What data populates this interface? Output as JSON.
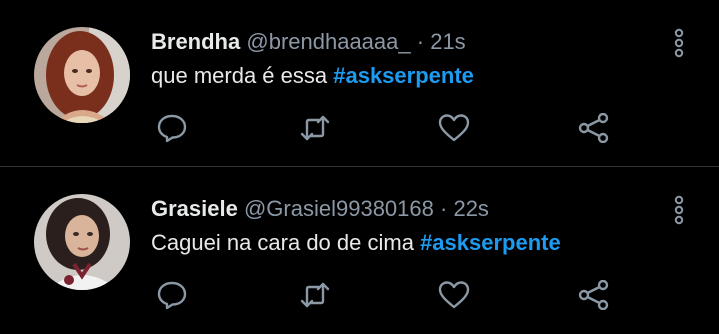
{
  "tweets": [
    {
      "name": "Brendha",
      "handle": "@brendhaaaaa_",
      "separator": "·",
      "time": "21s",
      "text": "que merda é essa ",
      "hashtag": "#askserpente"
    },
    {
      "name": "Grasiele",
      "handle": "@Grasiel99380168",
      "separator": "·",
      "time": "22s",
      "text": "Caguei na cara do de cima ",
      "hashtag": "#askserpente"
    }
  ],
  "colors": {
    "background": "#000000",
    "text": "#e7e9ea",
    "secondary": "#8b98a5",
    "accent": "#1d9bf0",
    "icon": "#8b98a5"
  },
  "icons": {
    "reply": "reply-icon",
    "retweet": "retweet-icon",
    "like": "heart-icon",
    "share": "share-icon",
    "more": "more-vertical-icon"
  }
}
